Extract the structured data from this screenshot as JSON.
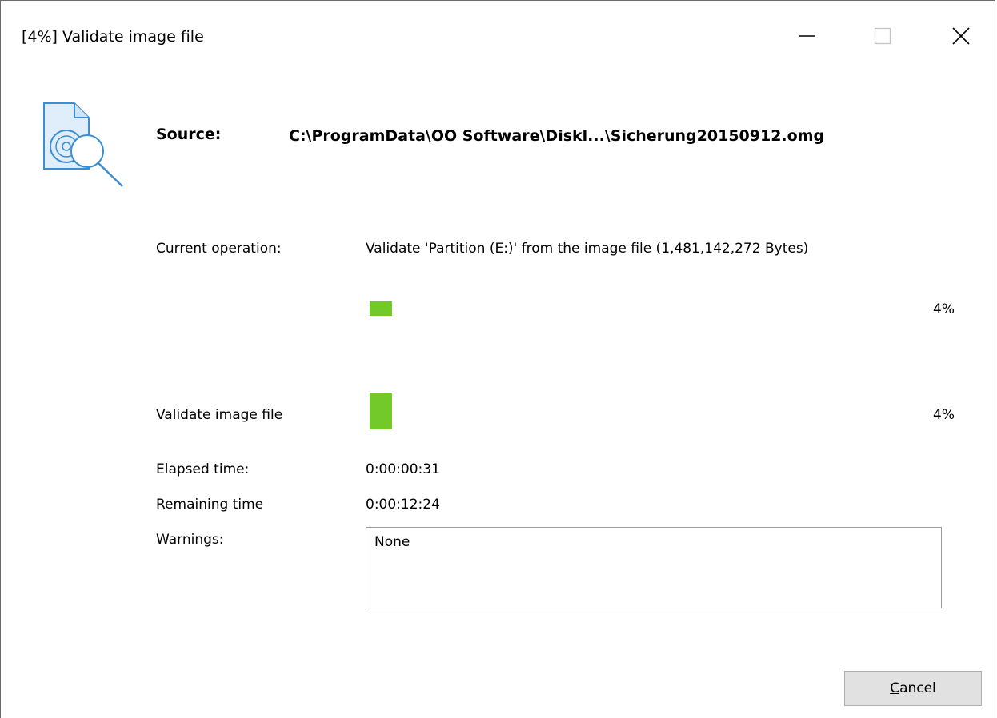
{
  "window": {
    "title": "[4%] Validate image file"
  },
  "header": {
    "source_label": "Source:",
    "source_path": "C:\\ProgramData\\OO Software\\Diskl...\\Sicherung20150912.omg"
  },
  "operation": {
    "label": "Current operation:",
    "description": "Validate 'Partition (E:)' from the image file (1,481,142,272 Bytes)",
    "progress": 0.04,
    "percent_text": "4%"
  },
  "overall": {
    "label": "Validate image file",
    "progress": 0.04,
    "percent_text": "4%"
  },
  "times": {
    "elapsed_label": "Elapsed time:",
    "elapsed_value": "0:00:00:31",
    "remaining_label": "Remaining time",
    "remaining_value": "0:00:12:24"
  },
  "warnings": {
    "label": "Warnings:",
    "value": "None"
  },
  "buttons": {
    "cancel_mnemonic": "C",
    "cancel_rest": "ancel"
  },
  "colors": {
    "progress_fill": "#73c92a",
    "icon_stroke": "#3b8ed1"
  },
  "icons": {
    "minimize": "minimize-icon",
    "maximize": "maximize-icon",
    "close": "close-icon",
    "header": "disk-image-search-icon"
  }
}
